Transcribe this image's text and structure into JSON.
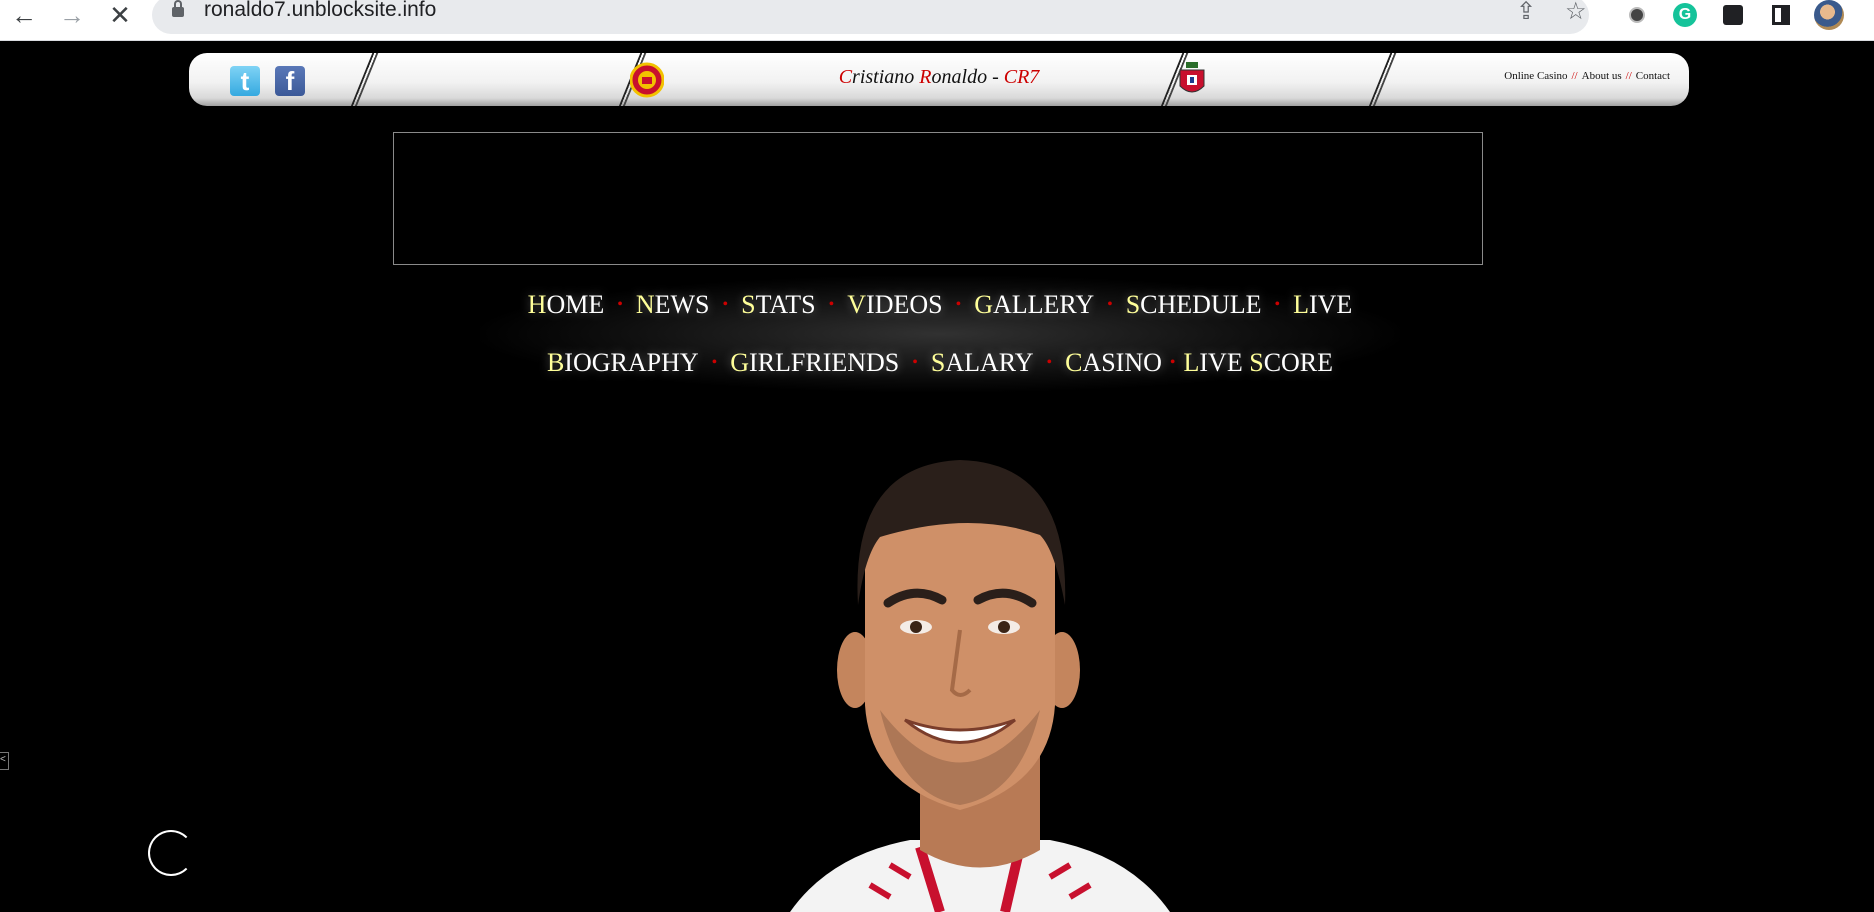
{
  "browser": {
    "url": "ronaldo7.unblocksite.info",
    "back_icon": "←",
    "forward_icon": "→",
    "stop_icon": "✕",
    "share_icon": "⇪",
    "bookmark_icon": "☆",
    "grammarly_letter": "G"
  },
  "header": {
    "twitter_glyph": "t",
    "facebook_glyph": "f",
    "title_c": "C",
    "title_rest1": "ristiano ",
    "title_r": "R",
    "title_rest2": "onaldo - ",
    "title_cr7": "CR7",
    "links": {
      "online_casino": "Online Casino",
      "about_us": "About us",
      "contact": "Contact",
      "separator": "//"
    }
  },
  "menu": {
    "row1": [
      {
        "first": "H",
        "rest": "OME"
      },
      {
        "first": "N",
        "rest": "EWS"
      },
      {
        "first": "S",
        "rest": "TATS"
      },
      {
        "first": "V",
        "rest": "IDEOS"
      },
      {
        "first": "G",
        "rest": "ALLERY"
      },
      {
        "first": "S",
        "rest": "CHEDULE"
      },
      {
        "first": "L",
        "rest": "IVE"
      }
    ],
    "row2": [
      {
        "first": "B",
        "rest": "IOGRAPHY"
      },
      {
        "first": "G",
        "rest": "IRLFRIENDS"
      },
      {
        "first": "S",
        "rest": "ALARY"
      },
      {
        "first": "C",
        "rest": "ASINO"
      },
      {
        "first": "L",
        "rest": "IVE ",
        "first2": "S",
        "rest2": "CORE"
      }
    ],
    "separator": "•"
  },
  "colors": {
    "accent_red": "#cc0000",
    "menu_initial": "#ffff99",
    "background": "#000000"
  },
  "side_marker": "<"
}
